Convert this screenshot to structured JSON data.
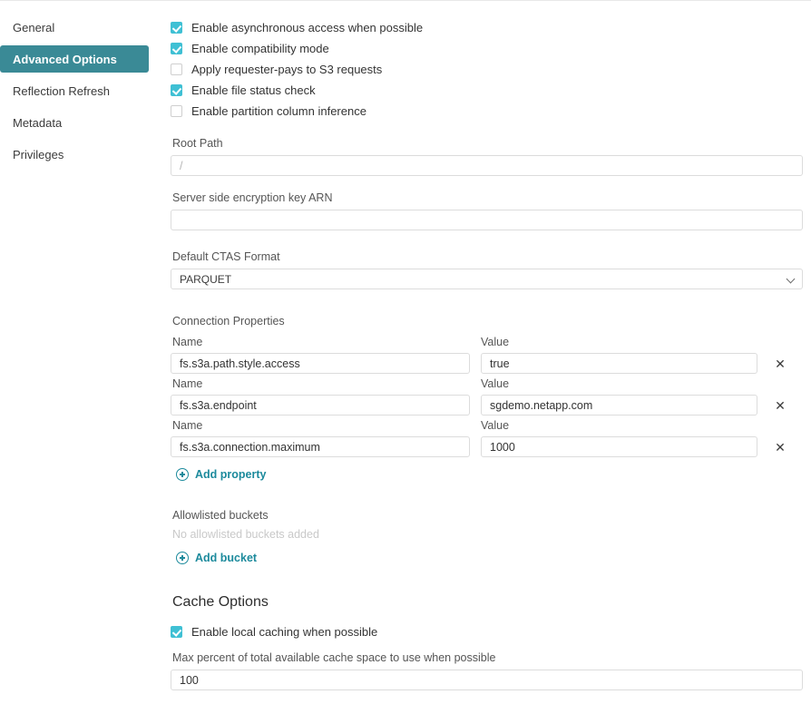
{
  "sidebar": {
    "items": [
      {
        "label": "General",
        "active": false
      },
      {
        "label": "Advanced Options",
        "active": true
      },
      {
        "label": "Reflection Refresh",
        "active": false
      },
      {
        "label": "Metadata",
        "active": false
      },
      {
        "label": "Privileges",
        "active": false
      }
    ]
  },
  "options": {
    "checkboxes": [
      {
        "label": "Enable asynchronous access when possible",
        "checked": true
      },
      {
        "label": "Enable compatibility mode",
        "checked": true
      },
      {
        "label": "Apply requester-pays to S3 requests",
        "checked": false
      },
      {
        "label": "Enable file status check",
        "checked": true
      },
      {
        "label": "Enable partition column inference",
        "checked": false
      }
    ]
  },
  "root_path": {
    "label": "Root Path",
    "value": "",
    "placeholder": "/"
  },
  "sse_key": {
    "label": "Server side encryption key ARN",
    "value": "",
    "placeholder": ""
  },
  "ctas": {
    "label": "Default CTAS Format",
    "value": "PARQUET"
  },
  "connection_properties": {
    "label": "Connection Properties",
    "name_header": "Name",
    "value_header": "Value",
    "remove_icon": "✕",
    "rows": [
      {
        "name": "fs.s3a.path.style.access",
        "value": "true"
      },
      {
        "name": "fs.s3a.endpoint",
        "value": "sgdemo.netapp.com"
      },
      {
        "name": "fs.s3a.connection.maximum",
        "value": "1000"
      }
    ],
    "add_label": "Add property"
  },
  "allowlisted_buckets": {
    "label": "Allowlisted buckets",
    "empty_text": "No allowlisted buckets added",
    "add_label": "Add bucket"
  },
  "cache_options": {
    "title": "Cache Options",
    "enable_label": "Enable local caching when possible",
    "enable_checked": true,
    "max_percent_label": "Max percent of total available cache space to use when possible",
    "max_percent_value": "100"
  },
  "colors": {
    "accent": "#1c8a9c",
    "active_nav": "#3a8a96",
    "checkbox": "#3fc0d4"
  }
}
